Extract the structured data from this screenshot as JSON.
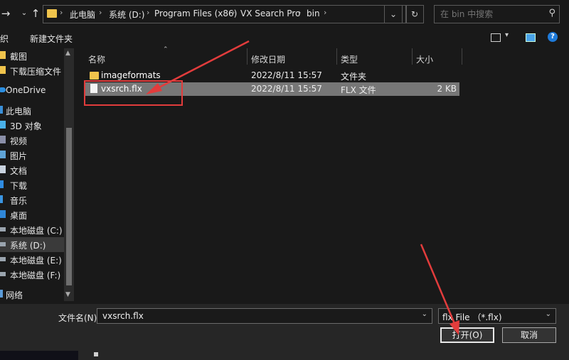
{
  "address": {
    "crumbs": [
      "此电脑",
      "系统 (D:)",
      "Program Files (x86)",
      "VX Search Pro",
      "bin"
    ]
  },
  "search": {
    "placeholder": "在 bin 中搜索"
  },
  "toolbar": {
    "organize_label": "织",
    "new_folder_label": "新建文件夹"
  },
  "sidebar": {
    "items": [
      {
        "label": "截图",
        "icon": "folder-icon"
      },
      {
        "label": "下载压缩文件",
        "icon": "folder-icon"
      },
      {
        "label": "OneDrive",
        "icon": "cloud-icon"
      },
      {
        "label": "此电脑",
        "icon": "computer-icon"
      },
      {
        "label": "3D 对象",
        "icon": "cube-icon"
      },
      {
        "label": "视频",
        "icon": "video-icon"
      },
      {
        "label": "图片",
        "icon": "picture-icon"
      },
      {
        "label": "文档",
        "icon": "document-icon"
      },
      {
        "label": "下载",
        "icon": "download-icon"
      },
      {
        "label": "音乐",
        "icon": "music-icon"
      },
      {
        "label": "桌面",
        "icon": "desktop-icon"
      },
      {
        "label": "本地磁盘 (C:)",
        "icon": "drive-icon"
      },
      {
        "label": "系统 (D:)",
        "icon": "drive-icon",
        "selected": true
      },
      {
        "label": "本地磁盘 (E:)",
        "icon": "drive-icon"
      },
      {
        "label": "本地磁盘 (F:)",
        "icon": "drive-icon"
      },
      {
        "label": "网络",
        "icon": "network-icon"
      }
    ]
  },
  "columns": {
    "name": "名称",
    "date": "修改日期",
    "type": "类型",
    "size": "大小"
  },
  "files": [
    {
      "name": "imageformats",
      "date": "2022/8/11 15:57",
      "type": "文件夹",
      "size": "",
      "icon": "folder-icon"
    },
    {
      "name": "vxsrch.flx",
      "date": "2022/8/11 15:57",
      "type": "FLX 文件",
      "size": "2 KB",
      "icon": "file-icon",
      "selected": true
    }
  ],
  "bottom": {
    "filename_label": "文件名(N):",
    "filename_value": "vxsrch.flx",
    "filter_value": "flx File （*.flx)",
    "open_label": "打开(O)",
    "cancel_label": "取消"
  },
  "colors": {
    "folder": "#f0c44c",
    "selection": "#777777",
    "annotation": "#e23c3c"
  }
}
